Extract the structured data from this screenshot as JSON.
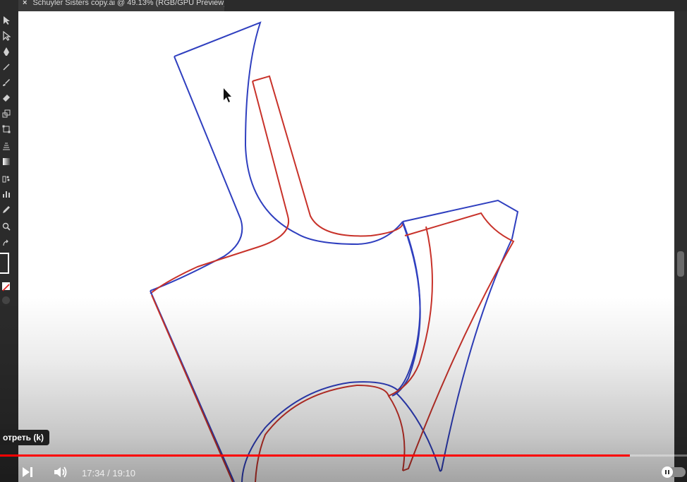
{
  "document_tab": {
    "close_glyph": "×",
    "title": "Schuyler Sisters copy.ai @ 49.13% (RGB/GPU Preview)"
  },
  "tools": [
    "selection-tool-icon",
    "direct-selection-tool-icon",
    "pen-tool-icon",
    "line-tool-icon",
    "brush-tool-icon",
    "eraser-tool-icon",
    "scale-tool-icon",
    "free-transform-tool-icon",
    "perspective-grid-tool-icon",
    "gradient-tool-icon",
    "symbol-sprayer-tool-icon",
    "graph-tool-icon",
    "eyedropper-tool-icon",
    "zoom-tool-icon",
    "swap-colors-icon"
  ],
  "colors": {
    "pattern_blue": "#2f3fbf",
    "pattern_red": "#c8322a",
    "progress_red": "#ff0000"
  },
  "player": {
    "tooltip": "отреть (k)",
    "current_time": "17:34",
    "separator": " / ",
    "duration": "19:10",
    "progress": 0.9165
  }
}
